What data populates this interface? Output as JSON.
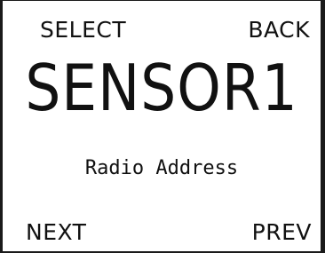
{
  "softkeys": {
    "top_left": "SELECT",
    "top_right": "BACK",
    "bottom_left": "NEXT",
    "bottom_right": "PREV"
  },
  "display": {
    "device_name": "SENSOR1",
    "menu_item": "Radio Address"
  }
}
